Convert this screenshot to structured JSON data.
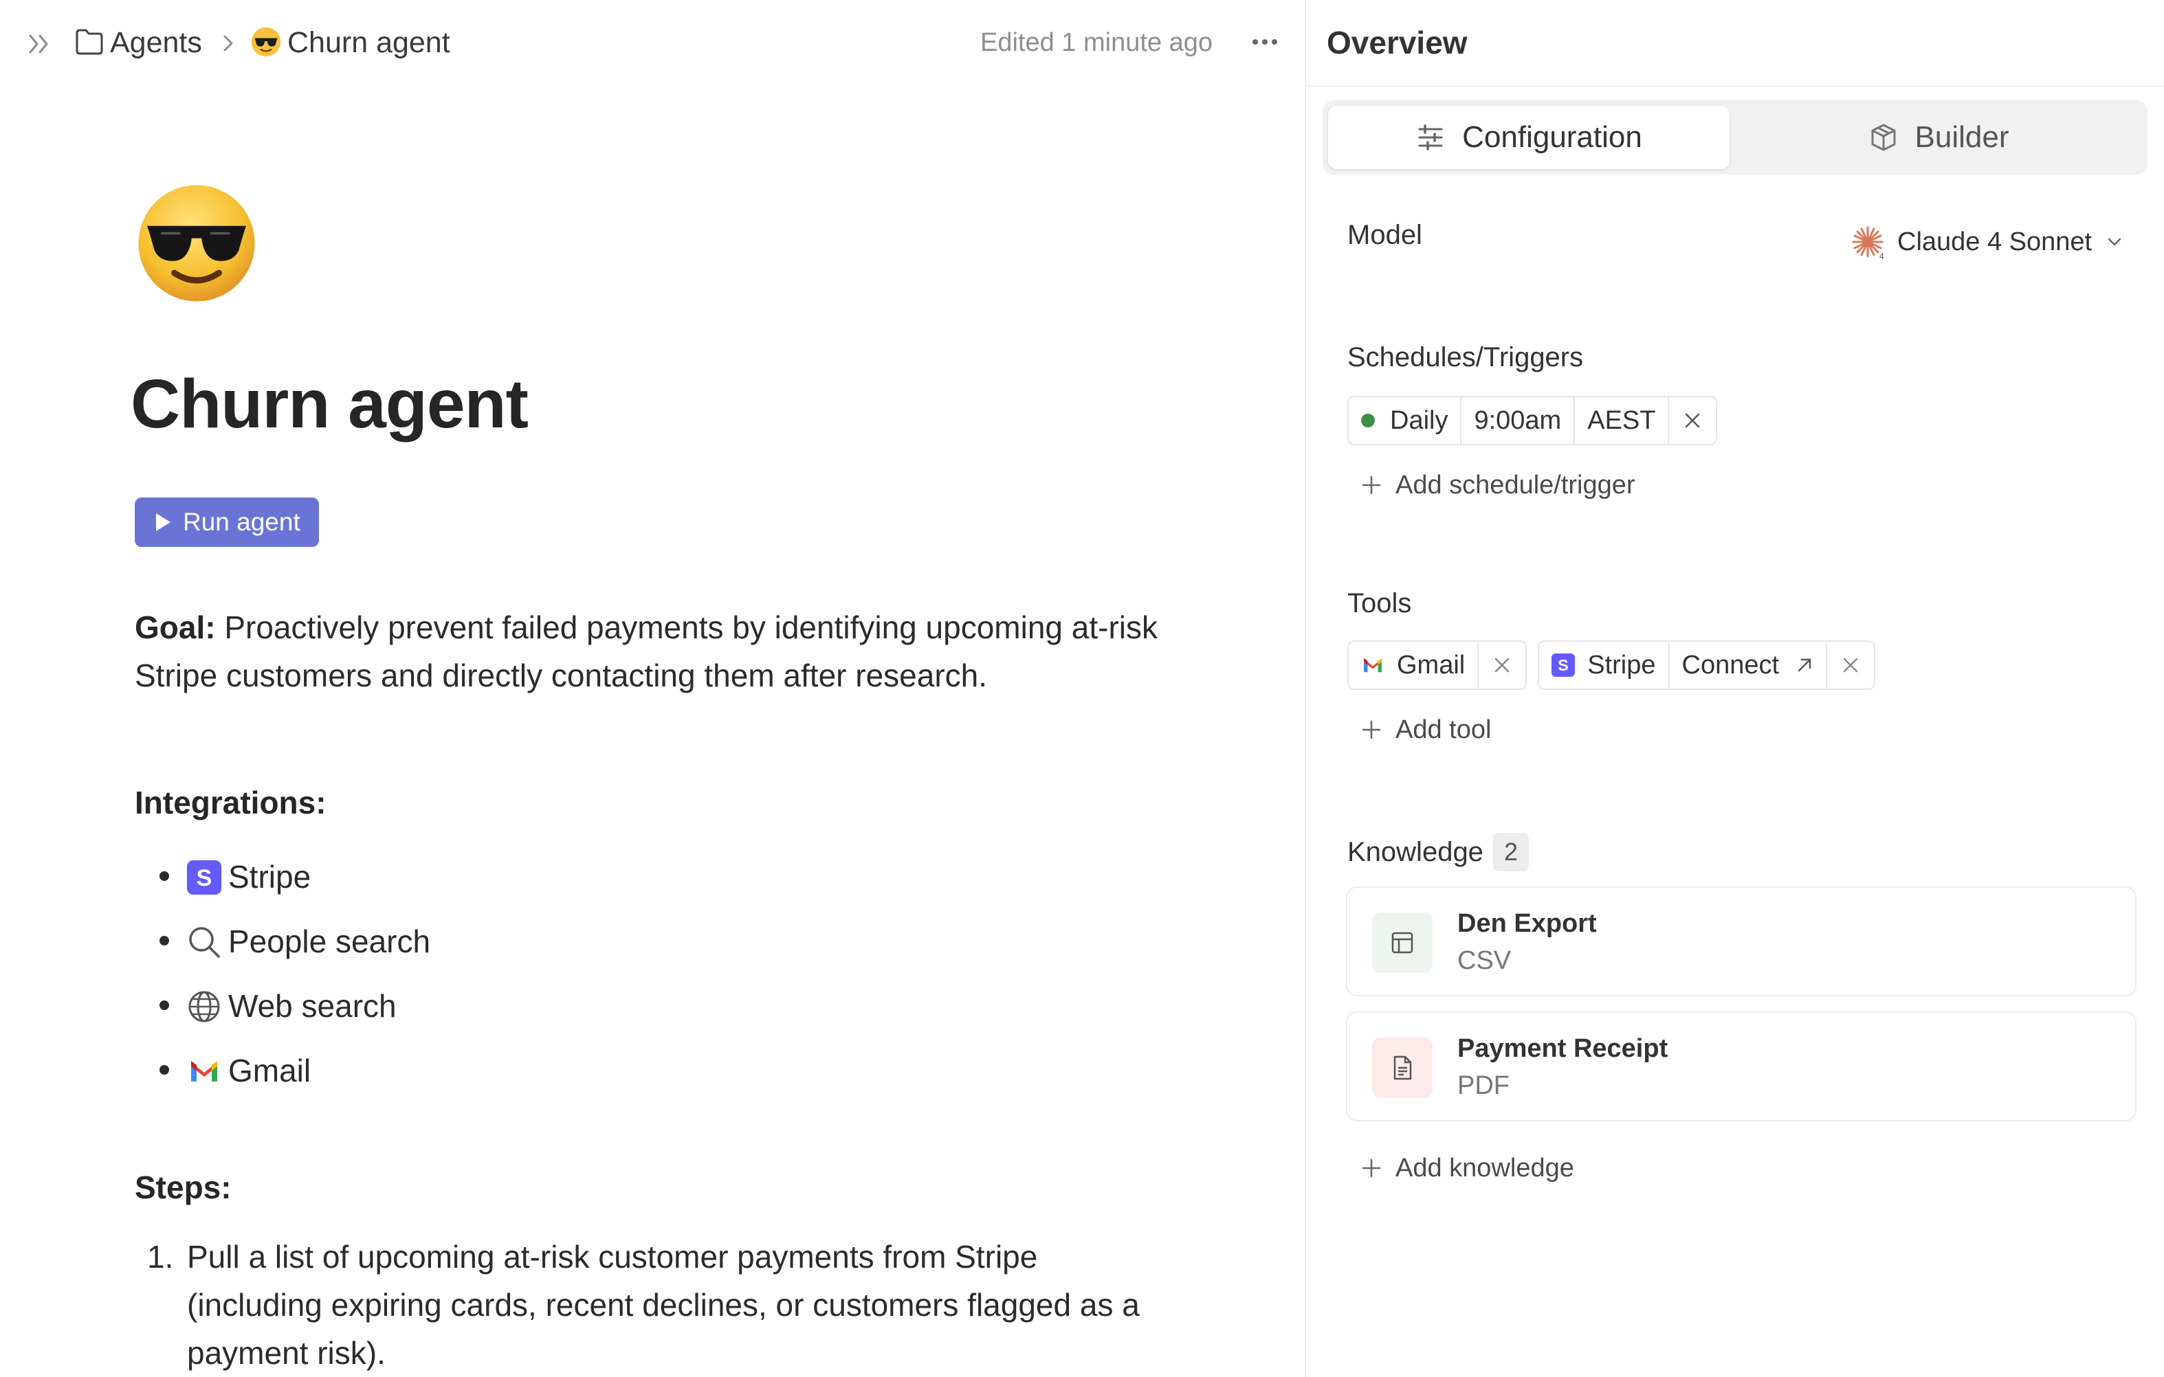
{
  "breadcrumb": {
    "parent": "Agents",
    "current_emoji": "😎",
    "current": "Churn agent",
    "edited": "Edited 1 minute ago"
  },
  "page": {
    "emoji": "😎",
    "title": "Churn agent",
    "run_button": "Run agent",
    "goal_label": "Goal:",
    "goal_text": " Proactively prevent failed payments by identifying upcoming at-risk Stripe customers and directly contacting them after research.",
    "integrations_heading": "Integrations:",
    "integrations": [
      {
        "label": "Stripe",
        "icon": "stripe-icon"
      },
      {
        "label": "People search",
        "icon": "search-icon"
      },
      {
        "label": "Web search",
        "icon": "globe-icon"
      },
      {
        "label": "Gmail",
        "icon": "gmail-icon"
      }
    ],
    "steps_heading": "Steps:",
    "steps": [
      {
        "num": "1.",
        "text": "Pull a list of upcoming at-risk customer payments from Stripe (including expiring cards, recent declines, or customers flagged as a payment risk)."
      }
    ]
  },
  "overview": {
    "title": "Overview",
    "tabs": [
      {
        "label": "Configuration",
        "icon": "sliders-icon",
        "active": true
      },
      {
        "label": "Builder",
        "icon": "cube-icon",
        "active": false
      }
    ],
    "model": {
      "label": "Model",
      "value": "Claude 4 Sonnet",
      "brand_color": "#d97757"
    },
    "schedules": {
      "label": "Schedules/Triggers",
      "items": [
        {
          "frequency": "Daily",
          "time": "9:00am",
          "timezone": "AEST",
          "status_color": "#3e8e41"
        }
      ],
      "add_label": "Add schedule/trigger"
    },
    "tools": {
      "label": "Tools",
      "items": [
        {
          "name": "Gmail",
          "icon": "gmail-icon"
        },
        {
          "name": "Stripe",
          "icon": "stripe-icon",
          "action": "Connect"
        }
      ],
      "add_label": "Add tool"
    },
    "knowledge": {
      "label": "Knowledge",
      "count": "2",
      "items": [
        {
          "name": "Den Export",
          "type": "CSV",
          "icon": "table-icon",
          "tint": "#eef5ee"
        },
        {
          "name": "Payment Receipt",
          "type": "PDF",
          "icon": "document-icon",
          "tint": "#fdeaea"
        }
      ],
      "add_label": "Add knowledge"
    }
  },
  "colors": {
    "accent": "#6a74d6",
    "stripe": "#635bff",
    "status_green": "#3e8e41"
  }
}
